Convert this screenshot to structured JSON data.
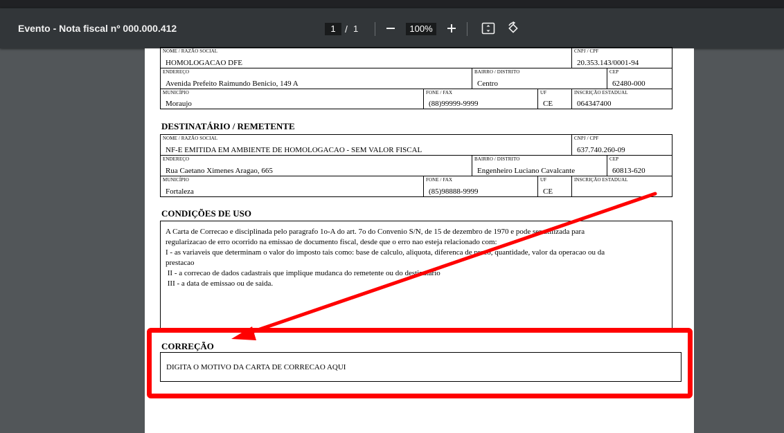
{
  "viewer": {
    "title": "Evento - Nota fiscal nº 000.000.412",
    "current_page": "1",
    "separator": "/",
    "total_pages": "1",
    "zoom": "100%"
  },
  "emitente": {
    "nome_label": "NOME / RAZÃO SOCIAL",
    "nome": "HOMOLOGACAO DFE",
    "cnpj_label": "CNPJ / CPF",
    "cnpj": "20.353.143/0001-94",
    "endereco_label": "ENDEREÇO",
    "endereco": "Avenida Prefeito Raimundo Benicio, 149 A",
    "bairro_label": "BAIRRO / DISTRITO",
    "bairro": "Centro",
    "cep_label": "CEP",
    "cep": "62480-000",
    "municipio_label": "MUNICÍPIO",
    "municipio": "Moraujo",
    "fone_label": "FONE / FAX",
    "fone": "(88)99999-9999",
    "uf_label": "UF",
    "uf": "CE",
    "ie_label": "INSCRIÇÃO ESTADUAL",
    "ie": "064347400"
  },
  "destinatario": {
    "title": "DESTINATÁRIO / REMETENTE",
    "nome_label": "NOME / RAZÃO SOCIAL",
    "nome": "NF-E EMITIDA EM AMBIENTE DE HOMOLOGACAO - SEM VALOR FISCAL",
    "cnpj_label": "CNPJ / CPF",
    "cnpj": "637.740.260-09",
    "endereco_label": "ENDEREÇO",
    "endereco": "Rua Caetano Ximenes Aragao, 665",
    "bairro_label": "BAIRRO / DISTRITO",
    "bairro": "Engenheiro Luciano Cavalcante",
    "cep_label": "CEP",
    "cep": "60813-620",
    "municipio_label": "MUNICÍPIO",
    "municipio": "Fortaleza",
    "fone_label": "FONE / FAX",
    "fone": "(85)98888-9999",
    "uf_label": "UF",
    "uf": "CE",
    "ie_label": "INSCRIÇÃO ESTADUAL",
    "ie": ""
  },
  "condicoes": {
    "title": "CONDIÇÕES DE USO",
    "text": "A Carta de Correcao e disciplinada pelo paragrafo 1o-A do art. 7o do Convenio S/N, de 15 de dezembro de 1970 e pode ser utilizada para\nregularizacao de erro ocorrido na emissao de documento fiscal, desde que o erro nao esteja relacionado com:\nI - as variaveis que determinam o valor do imposto tais como: base de calculo, aliquota, diferenca de preco, quantidade, valor da operacao ou da\nprestacao\n II - a correcao de dados cadastrais que implique mudanca do remetente ou do destinatario\n III - a data de emissao ou de saida."
  },
  "correcao": {
    "title": "CORREÇÃO",
    "text": "DIGITA O MOTIVO DA CARTA DE CORRECAO AQUI"
  },
  "annotation": {
    "color": "#ff0000"
  }
}
